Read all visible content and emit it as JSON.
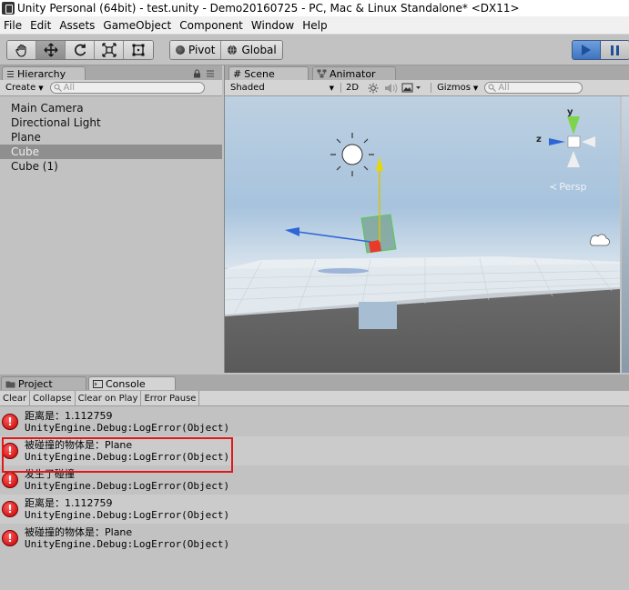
{
  "window": {
    "title": "Unity Personal (64bit) - test.unity - Demo20160725 - PC, Mac & Linux Standalone* <DX11>"
  },
  "menu": [
    "File",
    "Edit",
    "Assets",
    "GameObject",
    "Component",
    "Window",
    "Help"
  ],
  "toolbar": {
    "tools": [
      "hand-icon",
      "move-icon",
      "rotate-icon",
      "scale-icon",
      "rect-icon"
    ],
    "pivot_label": "Pivot",
    "global_label": "Global"
  },
  "hierarchy": {
    "tab_label": "Hierarchy",
    "create_label": "Create",
    "search_placeholder": "All",
    "items": [
      "Main Camera",
      "Directional Light",
      "Plane",
      "Cube",
      "Cube (1)"
    ],
    "selected": "Cube"
  },
  "scene": {
    "tab_scene": "Scene",
    "tab_animator": "Animator",
    "shading": "Shaded",
    "mode_2d": "2D",
    "gizmos_label": "Gizmos",
    "search_placeholder": "All",
    "persp_label": "Persp",
    "axis_y": "y",
    "axis_z": "z"
  },
  "bottom": {
    "tab_project": "Project",
    "tab_console": "Console",
    "buttons": [
      "Clear",
      "Collapse",
      "Clear on Play",
      "Error Pause"
    ]
  },
  "logs": [
    {
      "line1": "距离是：1.112759",
      "line2": "UnityEngine.Debug:LogError(Object)"
    },
    {
      "line1": "被碰撞的物体是：Plane",
      "line2": "UnityEngine.Debug:LogError(Object)"
    },
    {
      "line1": "发生了碰撞",
      "line2": "UnityEngine.Debug:LogError(Object)"
    },
    {
      "line1": "距离是：1.112759",
      "line2": "UnityEngine.Debug:LogError(Object)"
    },
    {
      "line1": "被碰撞的物体是：Plane",
      "line2": "UnityEngine.Debug:LogError(Object)"
    }
  ],
  "colors": {
    "accent": "#3d74c0",
    "error": "#c20000",
    "highlight": "#e01818"
  }
}
